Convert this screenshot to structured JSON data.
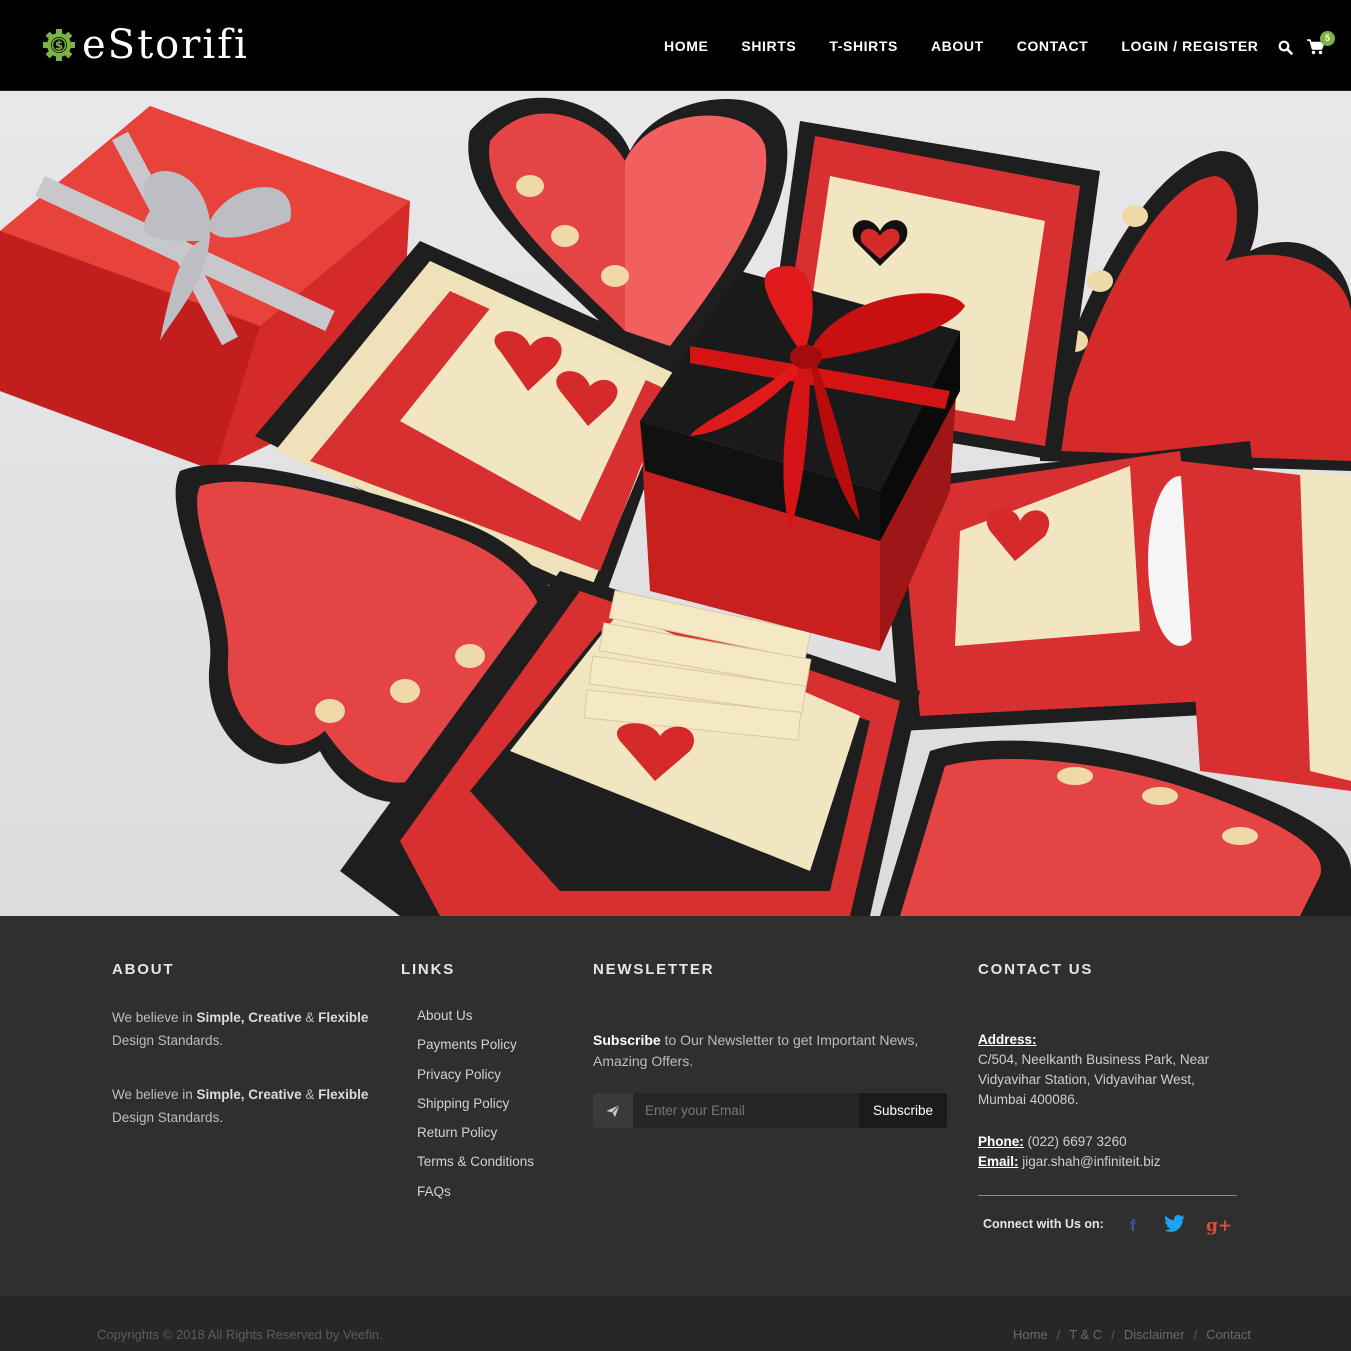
{
  "brand": {
    "name": "eStorifi",
    "accent": "#7cb342"
  },
  "nav": {
    "items": [
      "HOME",
      "SHIRTS",
      "T-SHIRTS",
      "ABOUT",
      "CONTACT",
      "LOGIN / REGISTER"
    ],
    "search_icon": "search-icon",
    "cart_icon": "cart-icon",
    "cart_count": "5"
  },
  "hero": {
    "image": "explosion-gift-box-with-hearts"
  },
  "footer": {
    "about": {
      "title": "ABOUT",
      "para1": {
        "pre": "We believe in ",
        "bold": "Simple, Creative",
        "amp": " & ",
        "bold2": "Flexible",
        "post": "Design Standards."
      },
      "para2": {
        "pre": "We believe in ",
        "bold": "Simple, Creative",
        "amp": " & ",
        "bold2": "Flexible",
        "post": "Design Standards."
      }
    },
    "links": {
      "title": "LINKS",
      "items": [
        "About Us",
        "Payments Policy",
        "Privacy Policy",
        "Shipping Policy",
        "Return Policy",
        "Terms & Conditions",
        "FAQs"
      ]
    },
    "newsletter": {
      "title": "NEWSLETTER",
      "text_bold": "Subscribe",
      "text_rest": " to Our Newsletter to get Important News, Amazing Offers.",
      "placeholder": "Enter your Email",
      "button": "Subscribe"
    },
    "contact": {
      "title": "CONTACT US",
      "address_label": "Address:",
      "address": "C/504, Neelkanth Business Park, Near Vidyavihar Station, Vidyavihar West, Mumbai 400086.",
      "phone_label": "Phone:",
      "phone": " (022) 6697 3260",
      "email_label": "Email:",
      "email": " jigar.shah@infiniteit.biz",
      "connect": "Connect with Us on:",
      "social": {
        "facebook": "f",
        "google": "g+"
      }
    }
  },
  "bottom": {
    "copyright": "Copyrights © 2018 All Rights Reserved by Veefin.",
    "links": [
      "Home",
      "T & C",
      "Disclaimer",
      "Contact"
    ],
    "separator": "/"
  }
}
